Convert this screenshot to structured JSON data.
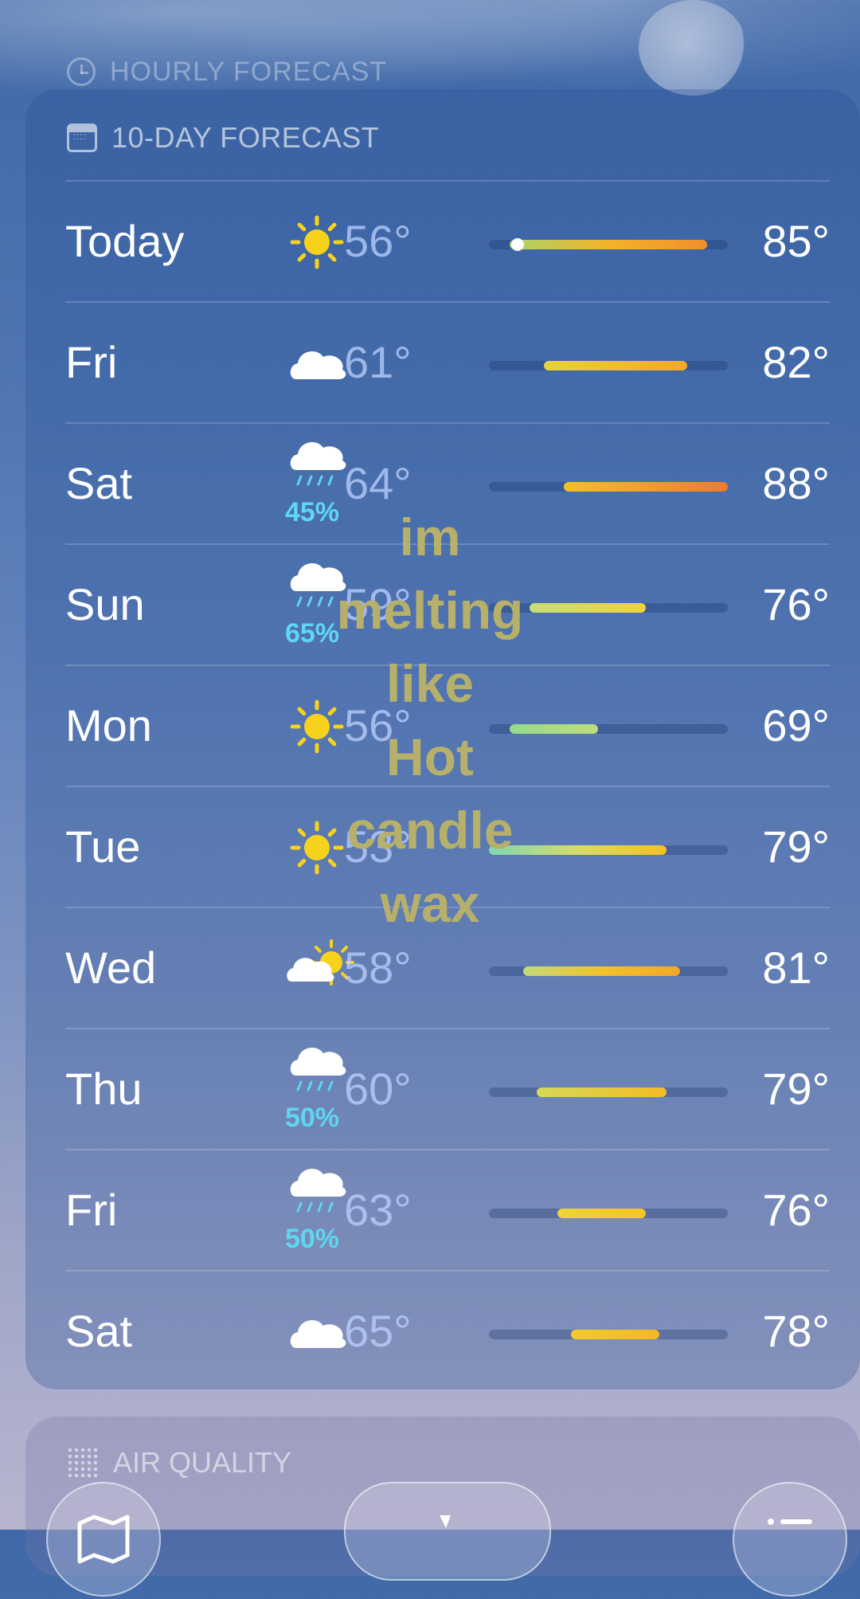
{
  "hourly_label": "HOURLY FORECAST",
  "forecast_label": "10-DAY FORECAST",
  "overlay_text": [
    "im",
    "melting",
    "like",
    "Hot",
    "candle",
    "wax"
  ],
  "air_quality_label": "AIR QUALITY",
  "days": [
    {
      "day": "Today",
      "icon": "sun-icon",
      "precip": "",
      "low": "56°",
      "high": "85°",
      "low_val": 56,
      "high_val": 85,
      "current": true,
      "colors": [
        "#a9d36a",
        "#f4b328",
        "#f0902c"
      ]
    },
    {
      "day": "Fri",
      "icon": "cloud-icon",
      "precip": "",
      "low": "61°",
      "high": "82°",
      "low_val": 61,
      "high_val": 82,
      "colors": [
        "#e6d33a",
        "#f2a82a"
      ]
    },
    {
      "day": "Sat",
      "icon": "rain-cloud-icon",
      "precip": "45%",
      "low": "64°",
      "high": "88°",
      "low_val": 64,
      "high_val": 88,
      "colors": [
        "#f2c124",
        "#f07a2e"
      ]
    },
    {
      "day": "Sun",
      "icon": "rain-cloud-icon",
      "precip": "65%",
      "low": "59°",
      "high": "76°",
      "low_val": 59,
      "high_val": 76,
      "colors": [
        "#c8dd78",
        "#efd33b"
      ]
    },
    {
      "day": "Mon",
      "icon": "sun-icon",
      "precip": "",
      "low": "56°",
      "high": "69°",
      "low_val": 56,
      "high_val": 69,
      "colors": [
        "#95d98f",
        "#c0dd7a"
      ]
    },
    {
      "day": "Tue",
      "icon": "sun-icon",
      "precip": "",
      "low": "53°",
      "high": "79°",
      "low_val": 53,
      "high_val": 79,
      "colors": [
        "#7fd7b6",
        "#d7dc6a",
        "#f5c023"
      ]
    },
    {
      "day": "Wed",
      "icon": "partly-cloudy-icon",
      "precip": "",
      "low": "58°",
      "high": "81°",
      "low_val": 58,
      "high_val": 81,
      "colors": [
        "#c2da7a",
        "#f2c22a",
        "#f2a82a"
      ]
    },
    {
      "day": "Thu",
      "icon": "rain-cloud-icon",
      "precip": "50%",
      "low": "60°",
      "high": "79°",
      "low_val": 60,
      "high_val": 79,
      "colors": [
        "#d4d85a",
        "#f5bb24"
      ]
    },
    {
      "day": "Fri",
      "icon": "rain-cloud-icon",
      "precip": "50%",
      "low": "63°",
      "high": "76°",
      "low_val": 63,
      "high_val": 76,
      "colors": [
        "#eed43a",
        "#f3c523"
      ]
    },
    {
      "day": "Sat",
      "icon": "cloud-icon",
      "precip": "",
      "low": "65°",
      "high": "78°",
      "low_val": 65,
      "high_val": 78,
      "colors": [
        "#f3ca2a",
        "#f3b824"
      ]
    }
  ],
  "range_min": 53,
  "range_max": 88,
  "colors": {
    "precip": "#5fd6f2",
    "sun": "#f7d21c",
    "overlay": "#b7b06b"
  }
}
